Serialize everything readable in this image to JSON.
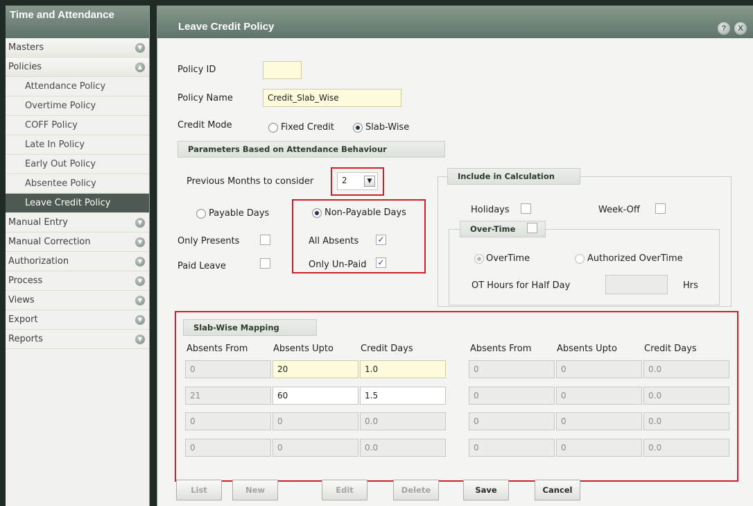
{
  "sidebar": {
    "title": "Time and Attendance",
    "items": [
      {
        "label": "Masters"
      },
      {
        "label": "Policies"
      },
      {
        "label": "Manual Entry"
      },
      {
        "label": "Manual Correction"
      },
      {
        "label": "Authorization"
      },
      {
        "label": "Process"
      },
      {
        "label": "Views"
      },
      {
        "label": "Export"
      },
      {
        "label": "Reports"
      }
    ],
    "policies": [
      {
        "label": "Attendance Policy"
      },
      {
        "label": "Overtime Policy"
      },
      {
        "label": "COFF Policy"
      },
      {
        "label": "Late In Policy"
      },
      {
        "label": "Early Out Policy"
      },
      {
        "label": "Absentee Policy"
      },
      {
        "label": "Leave Credit Policy"
      }
    ]
  },
  "panel": {
    "title": "Leave Credit Policy",
    "help_label": "?",
    "close_label": "X"
  },
  "form": {
    "policy_id_label": "Policy ID",
    "policy_id_value": "",
    "policy_name_label": "Policy Name",
    "policy_name_value": "Credit_Slab_Wise",
    "credit_mode_label": "Credit Mode",
    "fixed_credit_label": "Fixed Credit",
    "slab_wise_label": "Slab-Wise",
    "credit_mode_selected": "Slab-Wise"
  },
  "params": {
    "header": "Parameters Based on Attendance Behaviour",
    "prev_months_label": "Previous Months to consider",
    "prev_months_value": "2",
    "payable_days_label": "Payable Days",
    "non_payable_days_label": "Non-Payable Days",
    "only_presents_label": "Only Presents",
    "paid_leave_label": "Paid Leave",
    "all_absents_label": "All Absents",
    "only_unpaid_label": "Only Un-Paid"
  },
  "include": {
    "header": "Include in Calculation",
    "holidays_label": "Holidays",
    "weekoff_label": "Week-Off",
    "overtime_header": "Over-Time",
    "overtime_label": "OverTime",
    "authorized_ot_label": "Authorized OverTime",
    "ot_half_day_label": "OT Hours for Half Day",
    "ot_half_day_value": "",
    "hrs_label": "Hrs"
  },
  "slab": {
    "header": "Slab-Wise Mapping",
    "columns": [
      "Absents From",
      "Absents Upto",
      "Credit Days"
    ],
    "left_rows": [
      {
        "from": "0",
        "upto": "20",
        "credit": "1.0"
      },
      {
        "from": "21",
        "upto": "60",
        "credit": "1.5"
      },
      {
        "from": "0",
        "upto": "0",
        "credit": "0.0"
      },
      {
        "from": "0",
        "upto": "0",
        "credit": "0.0"
      }
    ],
    "right_rows": [
      {
        "from": "0",
        "upto": "0",
        "credit": "0.0"
      },
      {
        "from": "0",
        "upto": "0",
        "credit": "0.0"
      },
      {
        "from": "0",
        "upto": "0",
        "credit": "0.0"
      },
      {
        "from": "0",
        "upto": "0",
        "credit": "0.0"
      }
    ]
  },
  "buttons": {
    "list": "List",
    "new": "New",
    "edit": "Edit",
    "delete": "Delete",
    "save": "Save",
    "cancel": "Cancel"
  }
}
